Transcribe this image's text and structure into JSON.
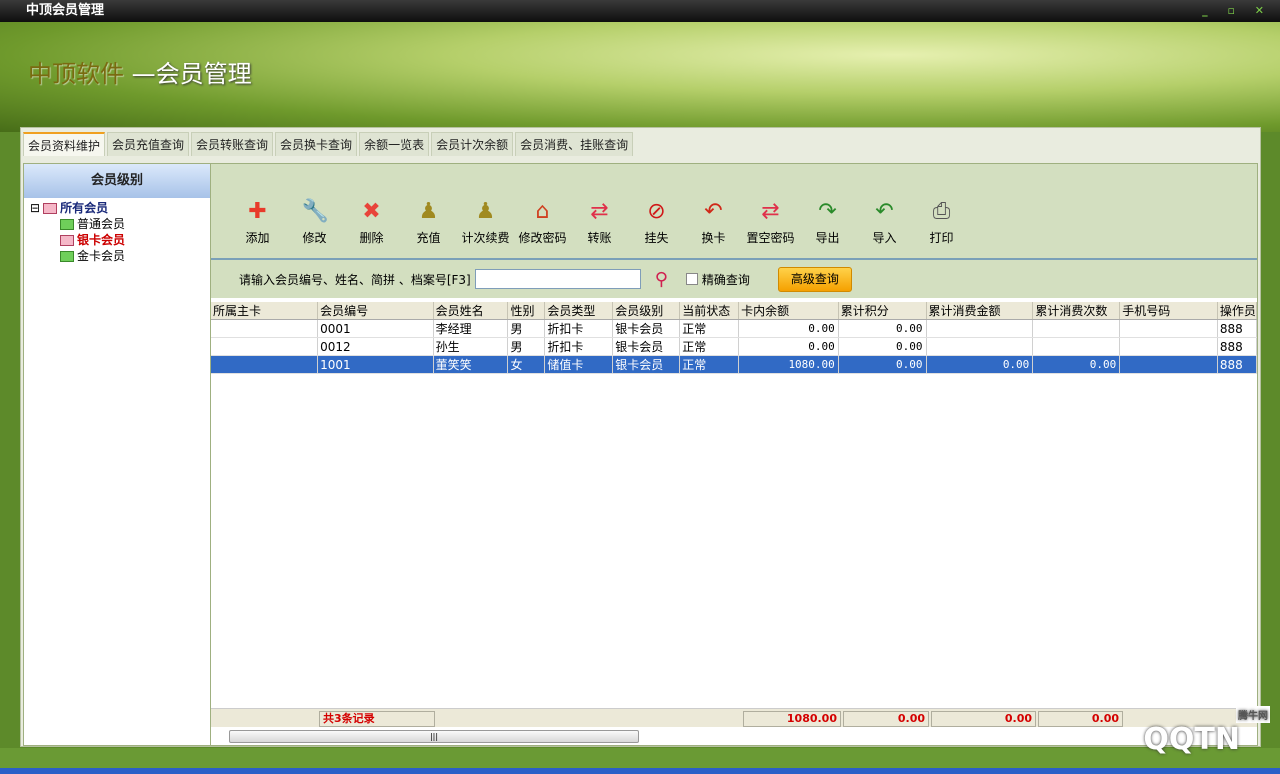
{
  "window": {
    "title": "中顶会员管理",
    "controls": [
      "_",
      "▫",
      "✕"
    ]
  },
  "banner": {
    "brand": "中顶软件",
    "subtitle": " —会员管理"
  },
  "tabs": [
    "会员资料维护",
    "会员充值查询",
    "会员转账查询",
    "会员换卡查询",
    "余额一览表",
    "会员计次余额",
    "会员消费、挂账查询"
  ],
  "sidebar": {
    "title": "会员级别",
    "root": "所有会员",
    "expander": "⊟",
    "items": [
      "普通会员",
      "银卡会员",
      "金卡会员"
    ]
  },
  "toolbar": [
    {
      "label": "添加",
      "icon": "plus-icon",
      "glyph": "✚",
      "color": "#e83a2a"
    },
    {
      "label": "修改",
      "icon": "wrench-icon",
      "glyph": "🔧",
      "color": "#d04020"
    },
    {
      "label": "删除",
      "icon": "delete-x-icon",
      "glyph": "✖",
      "color": "#e8443a"
    },
    {
      "label": "充值",
      "icon": "pawn-icon",
      "glyph": "♟",
      "color": "#a08a20"
    },
    {
      "label": "计次续费",
      "icon": "pawn-icon",
      "glyph": "♟",
      "color": "#a08a20"
    },
    {
      "label": "修改密码",
      "icon": "house-icon",
      "glyph": "⌂",
      "color": "#d04020"
    },
    {
      "label": "转账",
      "icon": "transfer-icon",
      "glyph": "⇄",
      "color": "#e0304a"
    },
    {
      "label": "挂失",
      "icon": "prohibited-icon",
      "glyph": "⊘",
      "color": "#d01818"
    },
    {
      "label": "换卡",
      "icon": "return-arrow-icon",
      "glyph": "↶",
      "color": "#d02818"
    },
    {
      "label": "置空密码",
      "icon": "reset-icon",
      "glyph": "⇄",
      "color": "#e0304a"
    },
    {
      "label": "导出",
      "icon": "excel-export-icon",
      "glyph": "↷",
      "color": "#2a8a2a"
    },
    {
      "label": "导入",
      "icon": "excel-import-icon",
      "glyph": "↶",
      "color": "#2a8a2a"
    },
    {
      "label": "打印",
      "icon": "printer-icon",
      "glyph": "⎙",
      "color": "#555"
    }
  ],
  "search": {
    "label": "请输入会员编号、姓名、简拼 、档案号[F3]",
    "value": "",
    "exact_label": "精确查询",
    "advanced_label": "高级查询"
  },
  "table": {
    "columns": [
      "所属主卡",
      "会员编号",
      "会员姓名",
      "性别",
      "会员类型",
      "会员级别",
      "当前状态",
      "卡内余额",
      "累计积分",
      "累计消费金额",
      "累计消费次数",
      "手机号码",
      "操作员"
    ],
    "sort_indicator": "/",
    "rows": [
      [
        "",
        "0001",
        "李经理",
        "男",
        "折扣卡",
        "银卡会员",
        "正常",
        "0.00",
        "0.00",
        "",
        "",
        "",
        "888"
      ],
      [
        "",
        "0012",
        "孙生",
        "男",
        "折扣卡",
        "银卡会员",
        "正常",
        "0.00",
        "0.00",
        "",
        "",
        "",
        "888"
      ],
      [
        "",
        "1001",
        "董笑笑",
        "女",
        "储值卡",
        "银卡会员",
        "正常",
        "1080.00",
        "0.00",
        "0.00",
        "0.00",
        "",
        "888"
      ]
    ],
    "selected_row": 2
  },
  "footer": {
    "count": "共3条记录",
    "totals": [
      "1080.00",
      "0.00",
      "0.00",
      "0.00"
    ],
    "scroll_grip": "|||"
  },
  "watermark": {
    "text": "QQTN",
    "site": "腾牛网"
  }
}
